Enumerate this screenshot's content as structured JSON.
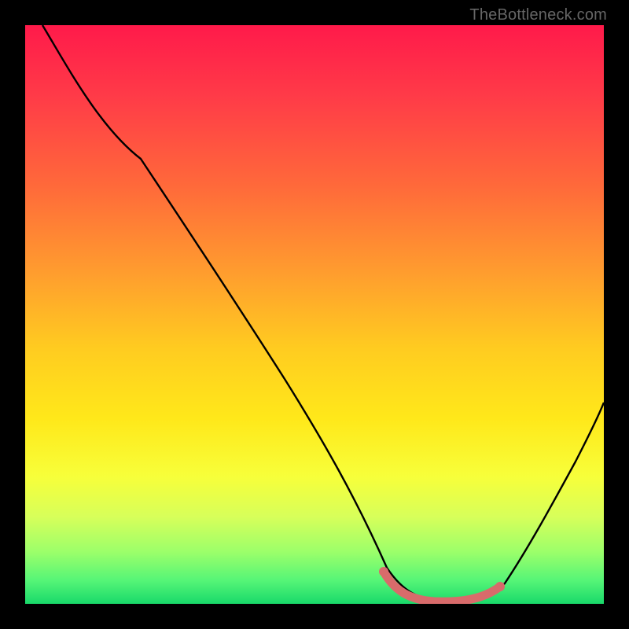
{
  "watermark": {
    "text": "TheBottleneck.com"
  },
  "colors": {
    "background": "#000000",
    "curve_stroke": "#000000",
    "highlight_stroke": "#d86b6b",
    "gradient_stops": [
      "#ff1a4a",
      "#ff3a48",
      "#ff6a3a",
      "#ff9a2f",
      "#ffcc20",
      "#ffe81a",
      "#f7ff3a",
      "#d7ff5a",
      "#9cff6a",
      "#55f577",
      "#19d96a"
    ]
  },
  "chart_data": {
    "type": "line",
    "title": "",
    "xlabel": "",
    "ylabel": "",
    "xlim": [
      0,
      100
    ],
    "ylim": [
      0,
      100
    ],
    "series": [
      {
        "name": "bottleneck-curve",
        "x": [
          3,
          10,
          20,
          30,
          40,
          50,
          55,
          60,
          65,
          70,
          75,
          80,
          85,
          90,
          100
        ],
        "y": [
          100,
          90,
          77,
          63,
          50,
          37,
          27,
          15,
          5,
          1,
          0.5,
          1,
          5,
          12,
          32
        ]
      }
    ],
    "highlight": {
      "name": "optimal-range",
      "x_start": 62,
      "x_end": 82,
      "y": 0.5
    }
  }
}
